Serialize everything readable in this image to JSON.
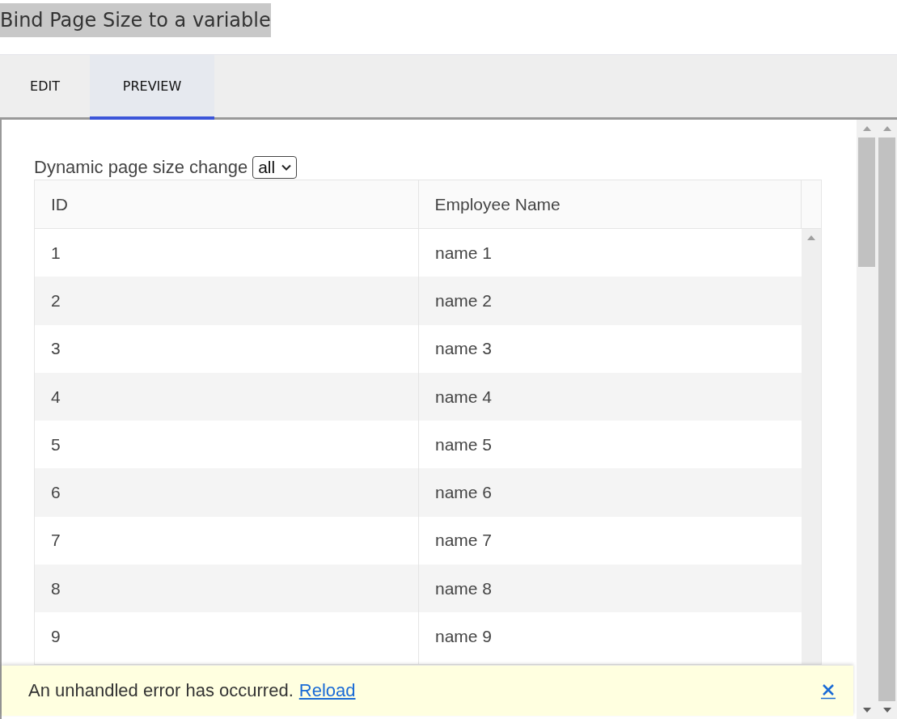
{
  "page_title": "Bind Page Size to a variable",
  "tabs": [
    {
      "label": "EDIT",
      "selected": false
    },
    {
      "label": "PREVIEW",
      "selected": true
    }
  ],
  "page_size": {
    "label": "Dynamic page size change",
    "value": "all"
  },
  "table": {
    "columns": [
      "ID",
      "Employee Name"
    ],
    "rows": [
      [
        "1",
        "name 1"
      ],
      [
        "2",
        "name 2"
      ],
      [
        "3",
        "name 3"
      ],
      [
        "4",
        "name 4"
      ],
      [
        "5",
        "name 5"
      ],
      [
        "6",
        "name 6"
      ],
      [
        "7",
        "name 7"
      ],
      [
        "8",
        "name 8"
      ],
      [
        "9",
        "name 9"
      ]
    ]
  },
  "error_banner": {
    "message": "An unhandled error has occurred.",
    "link": "Reload"
  }
}
